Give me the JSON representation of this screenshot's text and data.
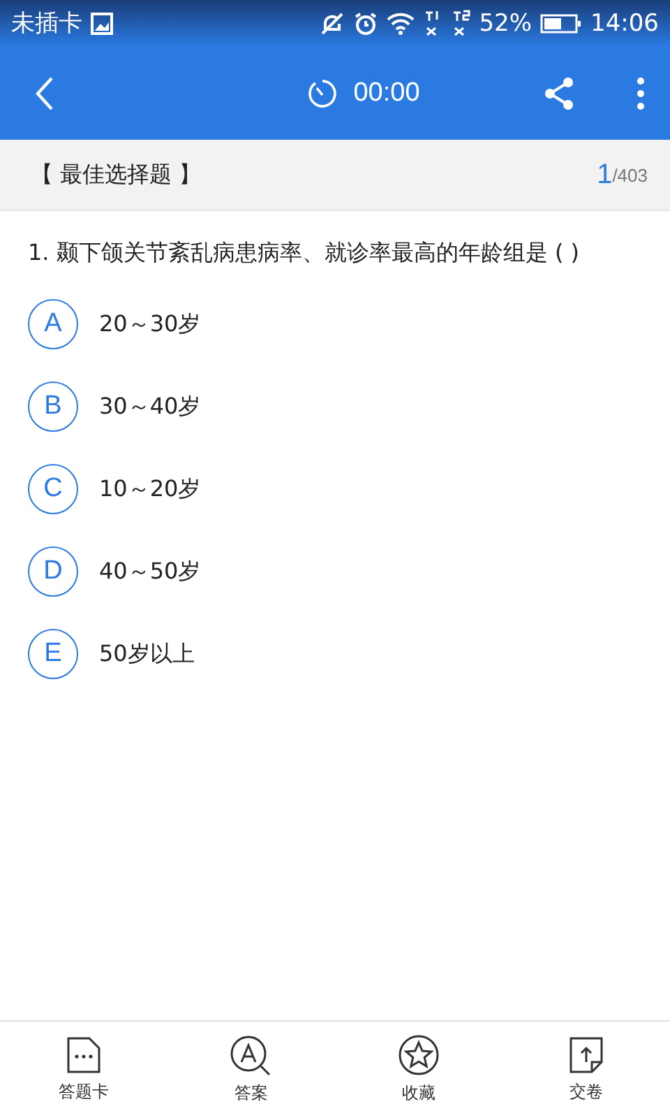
{
  "status_bar": {
    "carrier": "未插卡",
    "battery_percent": "52%",
    "time": "14:06"
  },
  "toolbar": {
    "timer": "00:00"
  },
  "section": {
    "title": "【 最佳选择题 】",
    "current": "1",
    "total": "/403"
  },
  "question": {
    "text": "1. 颞下颌关节紊乱病患病率、就诊率最高的年龄组是 ( )",
    "options": [
      {
        "letter": "A",
        "text": "20～30岁",
        "selected": false
      },
      {
        "letter": "B",
        "text": "30～40岁",
        "selected": false
      },
      {
        "letter": "C",
        "text": "10～20岁",
        "selected": false
      },
      {
        "letter": "D",
        "text": "40～50岁",
        "selected": false
      },
      {
        "letter": "E",
        "text": "50岁以上",
        "selected": false
      }
    ]
  },
  "bottom_nav": [
    {
      "kind": "card",
      "label": "答题卡"
    },
    {
      "kind": "answer",
      "label": "答案"
    },
    {
      "kind": "favorite",
      "label": "收藏"
    },
    {
      "kind": "submit",
      "label": "交卷"
    }
  ]
}
